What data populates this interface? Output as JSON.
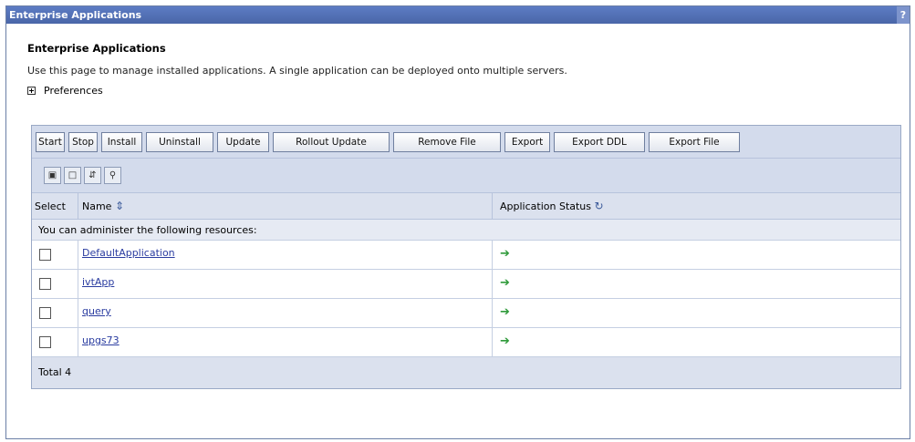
{
  "window": {
    "title": "Enterprise Applications",
    "help_label": "?"
  },
  "page": {
    "heading": "Enterprise Applications",
    "description": "Use this page to manage installed applications. A single application can be deployed onto multiple servers.",
    "preferences_label": "Preferences"
  },
  "toolbar": {
    "buttons": [
      "Start",
      "Stop",
      "Install",
      "Uninstall",
      "Update",
      "Rollout Update",
      "Remove File",
      "Export",
      "Export DDL",
      "Export File"
    ],
    "icons": [
      "select-all-icon",
      "deselect-all-icon",
      "show-filter-icon",
      "clear-filter-icon"
    ]
  },
  "table": {
    "headers": {
      "select": "Select",
      "name": "Name",
      "status": "Application Status"
    },
    "resources_caption": "You can administer the following resources:",
    "rows": [
      {
        "name": "DefaultApplication",
        "status_icon": "started-arrow-icon"
      },
      {
        "name": "ivtApp",
        "status_icon": "started-arrow-icon"
      },
      {
        "name": "query",
        "status_icon": "started-arrow-icon"
      },
      {
        "name": "upgs73",
        "status_icon": "started-arrow-icon"
      }
    ],
    "total": "Total 4"
  },
  "colors": {
    "title_bar": "#4a66a8",
    "panel_bg": "#d3dbec",
    "link": "#2a3ca0",
    "status_ok": "#2f9a3a"
  }
}
